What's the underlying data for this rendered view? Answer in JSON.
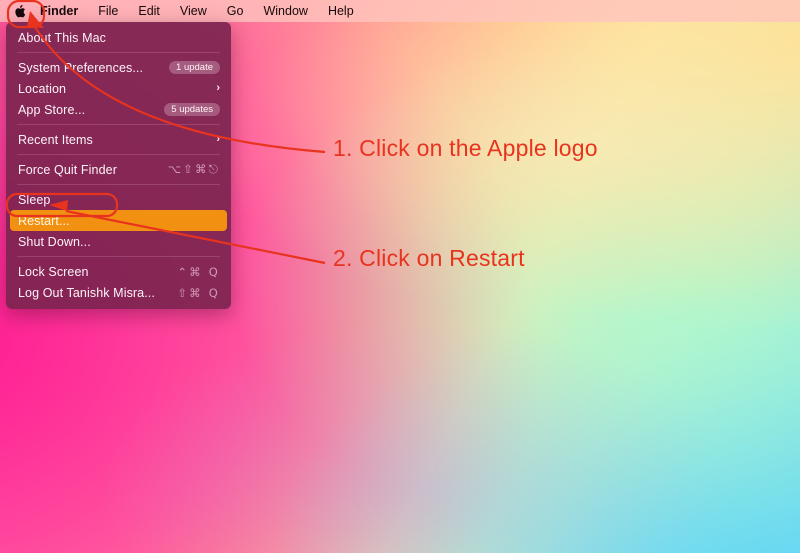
{
  "menubar": {
    "apple_logo_icon": "apple-logo-icon",
    "items": [
      {
        "label": "Finder",
        "bold": true
      },
      {
        "label": "File",
        "bold": false
      },
      {
        "label": "Edit",
        "bold": false
      },
      {
        "label": "View",
        "bold": false
      },
      {
        "label": "Go",
        "bold": false
      },
      {
        "label": "Window",
        "bold": false
      },
      {
        "label": "Help",
        "bold": false
      }
    ]
  },
  "apple_menu": {
    "items": [
      {
        "label": "About This Mac",
        "accessory": "none",
        "accessory_text": "",
        "highlighted": false
      },
      {
        "label": "System Preferences...",
        "accessory": "badge",
        "accessory_text": "1 update",
        "highlighted": false
      },
      {
        "label": "Location",
        "accessory": "chevron",
        "accessory_text": "›",
        "highlighted": false
      },
      {
        "label": "App Store...",
        "accessory": "badge",
        "accessory_text": "5 updates",
        "highlighted": false
      },
      {
        "label": "Recent Items",
        "accessory": "chevron",
        "accessory_text": "›",
        "highlighted": false
      },
      {
        "label": "Force Quit Finder",
        "accessory": "shortcut",
        "accessory_text": "⌥⇧⌘⎋",
        "highlighted": false
      },
      {
        "label": "Sleep",
        "accessory": "none",
        "accessory_text": "",
        "highlighted": false
      },
      {
        "label": "Restart...",
        "accessory": "none",
        "accessory_text": "",
        "highlighted": true
      },
      {
        "label": "Shut Down...",
        "accessory": "none",
        "accessory_text": "",
        "highlighted": false
      },
      {
        "label": "Lock Screen",
        "accessory": "shortcut",
        "accessory_text": "⌃⌘ Q",
        "highlighted": false
      },
      {
        "label": "Log Out Tanishk Misra...",
        "accessory": "shortcut",
        "accessory_text": "⇧⌘ Q",
        "highlighted": false
      }
    ],
    "highlight_color": "#f29011",
    "background_color": "#79244e"
  },
  "annotations": {
    "color": "#e8331f",
    "step1": "1. Click on the Apple logo",
    "step2": "2. Click on Restart"
  }
}
